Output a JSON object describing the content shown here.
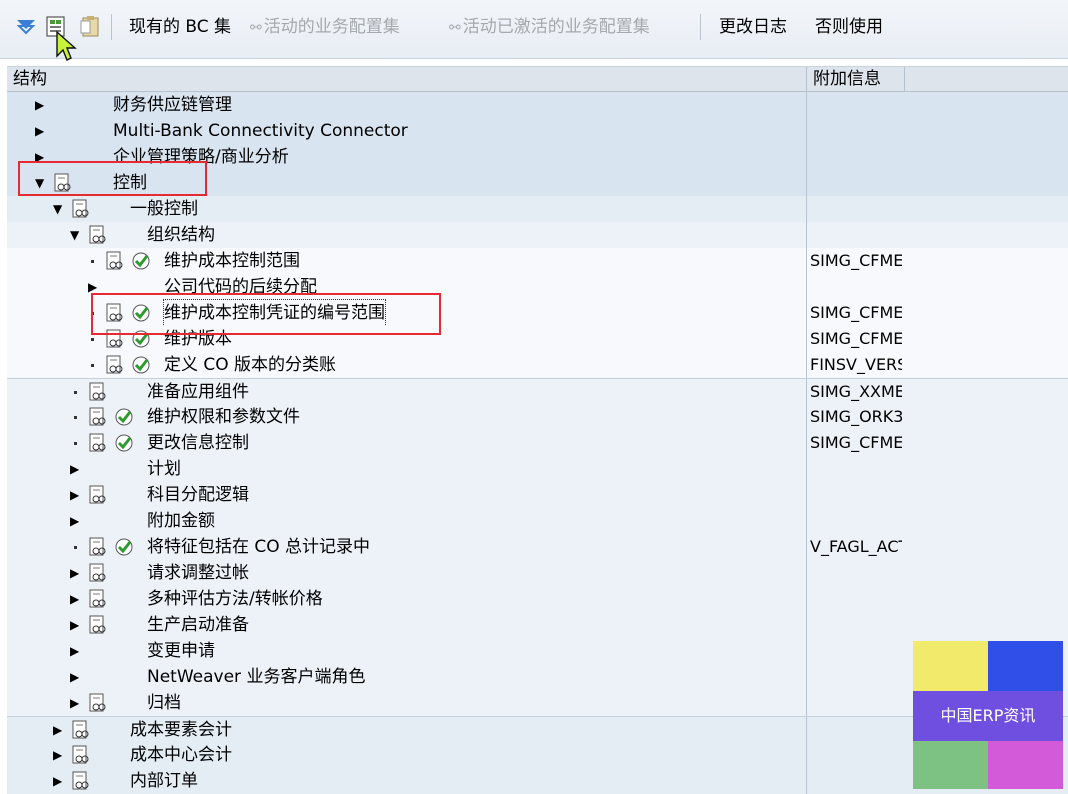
{
  "toolbar": {
    "buttons": [
      {
        "label": "现有的 BC 集",
        "enabled": true
      },
      {
        "label": "活动的业务配置集",
        "enabled": false
      },
      {
        "label": "活动已激活的业务配置集",
        "enabled": false
      },
      {
        "label": "更改日志",
        "enabled": true
      },
      {
        "label": "否则使用",
        "enabled": true
      }
    ]
  },
  "header": {
    "structure": "结构",
    "info": "附加信息"
  },
  "tree": [
    {
      "label": "财务供应链管理",
      "info": ""
    },
    {
      "label": "Multi-Bank Connectivity Connector",
      "info": ""
    },
    {
      "label": "企业管理策略/商业分析",
      "info": ""
    },
    {
      "label": "控制",
      "info": ""
    },
    {
      "label": "一般控制",
      "info": ""
    },
    {
      "label": "组织结构",
      "info": ""
    },
    {
      "label": "维护成本控制范围",
      "info": "SIMG_CFMENUORKEOKKP"
    },
    {
      "label": "公司代码的后续分配",
      "info": ""
    },
    {
      "label": "维护成本控制凭证的编号范围",
      "info": "SIMG_CFMENUORKEKANK"
    },
    {
      "label": "维护版本",
      "info": "SIMG_CFMENUOKEQOKEQ"
    },
    {
      "label": "定义 CO 版本的分类账",
      "info": "FINSV_VERSIONS"
    },
    {
      "label": "准备应用组件",
      "info": "SIMG_XXMENUOKKPOKKP"
    },
    {
      "label": "维护权限和参数文件",
      "info": "SIMG_ORK3"
    },
    {
      "label": "更改信息控制",
      "info": "SIMG_CFMENUOKBZOKBZ"
    },
    {
      "label": "计划",
      "info": ""
    },
    {
      "label": "科目分配逻辑",
      "info": ""
    },
    {
      "label": "附加金额",
      "info": ""
    },
    {
      "label": "将特征包括在 CO 总计记录中",
      "info": "V_FAGL_ACTIVEC"
    },
    {
      "label": "请求调整过帐",
      "info": ""
    },
    {
      "label": "多种评估方法/转帐价格",
      "info": ""
    },
    {
      "label": "生产启动准备",
      "info": ""
    },
    {
      "label": "变更申请",
      "info": ""
    },
    {
      "label": "NetWeaver 业务客户端角色",
      "info": ""
    },
    {
      "label": "归档",
      "info": ""
    },
    {
      "label": "成本要素会计",
      "info": ""
    },
    {
      "label": "成本中心会计",
      "info": ""
    },
    {
      "label": "内部订单",
      "info": ""
    }
  ],
  "watermark": {
    "text": "中国ERP资讯",
    "colors": [
      "#f2ea6a",
      "#2f4fe8",
      "#6f4fe0",
      "#7ec283",
      "#d35ad8"
    ]
  },
  "colors": {
    "highlight": "#e52a33",
    "header_bg": "#dde4ec"
  }
}
